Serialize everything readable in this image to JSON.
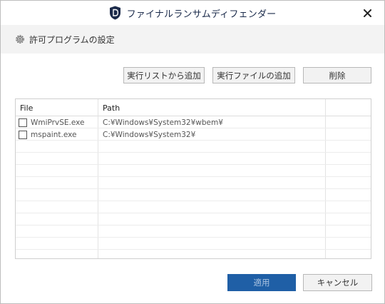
{
  "app": {
    "title": "ファイナルランサムディフェンダー"
  },
  "header": {
    "title": "許可プログラムの設定"
  },
  "toolbar": {
    "add_from_list_label": "実行リストから追加",
    "add_file_label": "実行ファイルの追加",
    "delete_label": "削除"
  },
  "table": {
    "columns": [
      "File",
      "Path"
    ],
    "rows": [
      {
        "file": "WmiPrvSE.exe",
        "path": "C:¥Windows¥System32¥wbem¥",
        "checked": false
      },
      {
        "file": "mspaint.exe",
        "path": "C:¥Windows¥System32¥",
        "checked": false
      }
    ]
  },
  "footer": {
    "apply_label": "適用",
    "cancel_label": "キャンセル"
  },
  "colors": {
    "apply_bg": "#1f5fa6",
    "logo_bg": "#1b2a4a",
    "header_bg": "#f3f3f3"
  },
  "icons": {
    "app_logo": "shield-d-logo-icon",
    "close": "close-icon",
    "settings": "gear-icon"
  }
}
